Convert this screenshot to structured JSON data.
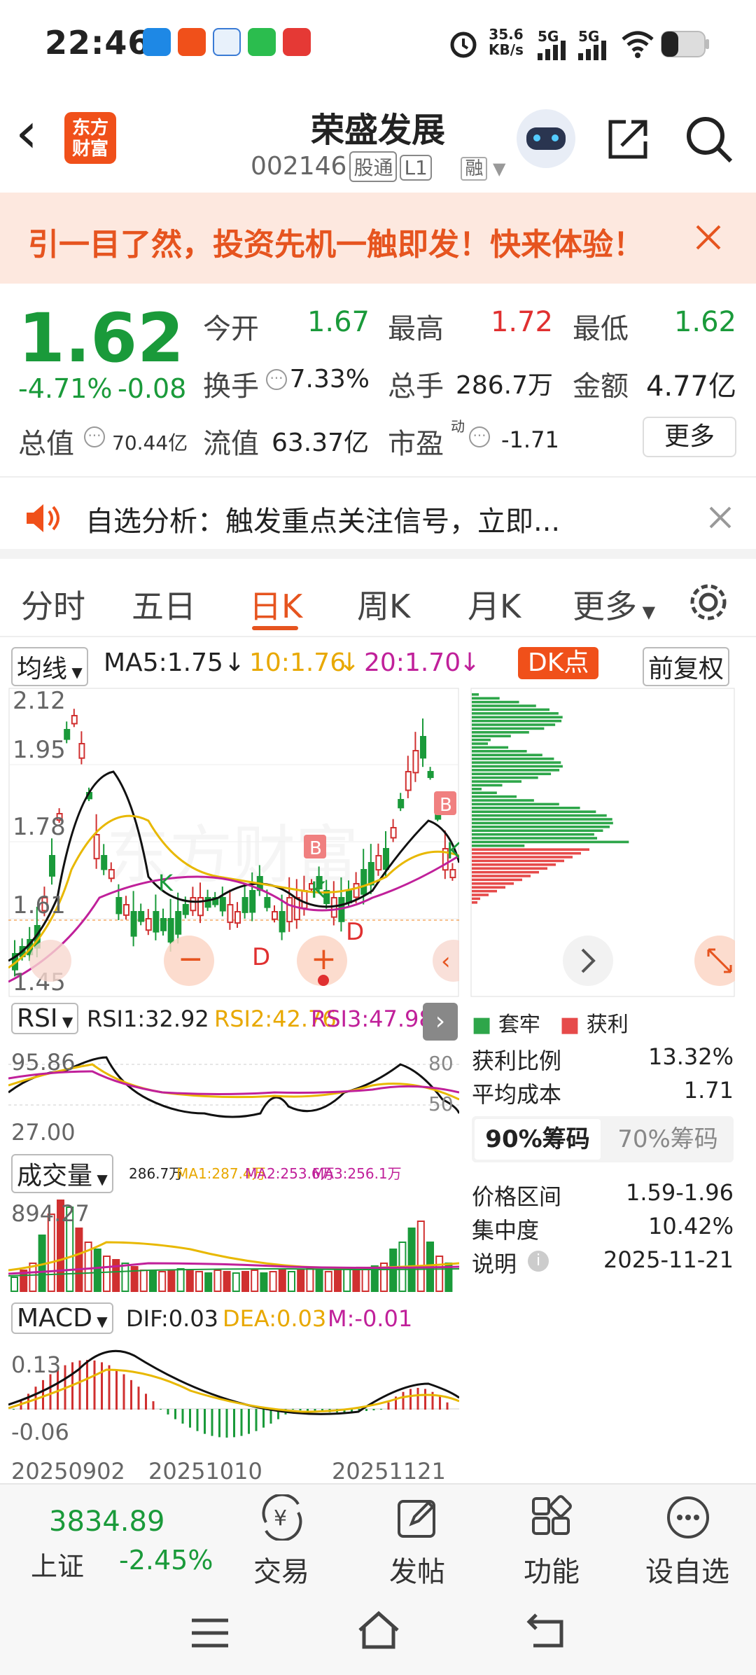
{
  "status_bar": {
    "time": "22:46",
    "net_speed": "35.6",
    "net_unit": "KB/s",
    "sig1": "5G",
    "sig2": "5G"
  },
  "header": {
    "back": "‹",
    "logo_line1": "东方",
    "logo_line2": "财富",
    "stock_name": "荣盛发展",
    "stock_code": "002146",
    "tag1": "股通",
    "tag2": "L1",
    "tag3": "融"
  },
  "banner": {
    "text": "引一目了然，投资先机一触即发！快来体验！"
  },
  "quote": {
    "price": "1.62",
    "change_pct": "-4.71%",
    "change": "-0.08",
    "open_label": "今开",
    "open": "1.67",
    "high_label": "最高",
    "high": "1.72",
    "low_label": "最低",
    "low": "1.62",
    "turnover_label": "换手",
    "turnover": "7.33%",
    "volume_label": "总手",
    "volume": "286.7万",
    "amount_label": "金额",
    "amount": "4.77亿",
    "mktcap_label": "总值",
    "mktcap": "70.44亿",
    "float_label": "流值",
    "float": "63.37亿",
    "pe_label": "市盈",
    "pe_sup": "动",
    "pe": "-1.71",
    "more": "更多"
  },
  "notice": {
    "text": "自选分析：触发重点关注信号，立即..."
  },
  "tabs": [
    "分时",
    "五日",
    "日K",
    "周K",
    "月K",
    "更多"
  ],
  "ma_bar": {
    "selector": "均线",
    "ma5": "MA5:1.75",
    "ma10": "10:1.76",
    "ma20": "20:1.70",
    "dk": "DK点",
    "adjust": "前复权"
  },
  "kchart": {
    "y_labels": [
      "2.12",
      "1.95",
      "1.78",
      "1.61",
      "1.45"
    ],
    "markers": [
      "B",
      "B",
      "K",
      "K",
      "K",
      "D",
      "D"
    ],
    "watermark": "东方财富"
  },
  "chips": {
    "legend_trap": "套牢",
    "legend_profit": "获利",
    "rows": [
      {
        "label": "获利比例",
        "value": "13.32%"
      },
      {
        "label": "平均成本",
        "value": "1.71"
      }
    ],
    "tab90": "90%筹码",
    "tab70": "70%筹码",
    "rows2": [
      {
        "label": "价格区间",
        "value": "1.59-1.96"
      },
      {
        "label": "集中度",
        "value": "10.42%"
      },
      {
        "label": "说明",
        "value": "2025-11-21"
      }
    ]
  },
  "rsi": {
    "selector": "RSI",
    "rsi1": "RSI1:32.92",
    "rsi2": "RSI2:42.76",
    "rsi3": "RSI3:47.98",
    "top": "95.86",
    "bottom": "27.00",
    "l80": "80",
    "l50": "50"
  },
  "vol": {
    "selector": "成交量",
    "v": "286.7万",
    "ma1": "MA1:287.4万",
    "ma2": "MA2:253.6万",
    "ma3": "MA3:256.1万",
    "top": "894.27"
  },
  "macd": {
    "selector": "MACD",
    "dif": "DIF:0.03",
    "dea": "DEA:0.03",
    "m": "M:-0.01",
    "top": "0.13",
    "bottom": "-0.06",
    "dates": [
      "20250902",
      "20251010",
      "20251121"
    ]
  },
  "bottom_nav": {
    "index_value": "3834.89",
    "index_name": "上证",
    "index_change": "-2.45%",
    "items": [
      "交易",
      "发帖",
      "功能",
      "设自选"
    ]
  }
}
